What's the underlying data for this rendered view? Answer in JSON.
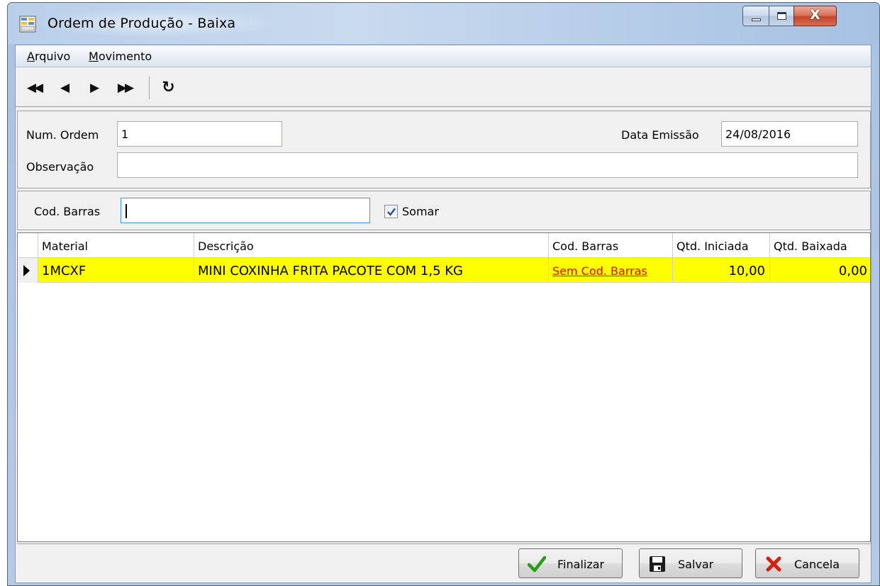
{
  "window": {
    "title": "Ordem de Produção - Baixa",
    "close_glyph": "X"
  },
  "menu": {
    "items": [
      {
        "mnemonic": "A",
        "rest": "rquivo"
      },
      {
        "mnemonic": "M",
        "rest": "ovimento"
      }
    ]
  },
  "toolbar": {
    "first": "◀◀",
    "prev": "◀",
    "next": "▶",
    "last": "▶▶",
    "refresh": "↻"
  },
  "header": {
    "num_ordem_label": "Num. Ordem",
    "num_ordem_value": "1",
    "data_emissao_label": "Data Emissão",
    "data_emissao_value": "24/08/2016",
    "observacao_label": "Observação",
    "observacao_value": ""
  },
  "barcode": {
    "label": "Cod. Barras",
    "value": "",
    "somar_label": "Somar",
    "somar_checked": true
  },
  "grid": {
    "columns": [
      "Material",
      "Descrição",
      "Cod. Barras",
      "Qtd. Iniciada",
      "Qtd. Baixada"
    ],
    "rows": [
      {
        "material": "1MCXF",
        "descricao": "MINI COXINHA FRITA PACOTE COM 1,5 KG",
        "cod_barras": "Sem Cod. Barras",
        "qtd_iniciada": "10,00",
        "qtd_baixada": "0,00"
      }
    ],
    "selected_row_color": "#ffff00",
    "link_color": "#ff0000"
  },
  "footer": {
    "finalizar": "Finalizar",
    "salvar": "Salvar",
    "cancela": "Cancela"
  },
  "icons": {
    "app": "form-grid-icon",
    "finalizar": "checkmark-icon",
    "salvar": "floppy-disk-icon",
    "cancela": "x-cross-icon"
  }
}
